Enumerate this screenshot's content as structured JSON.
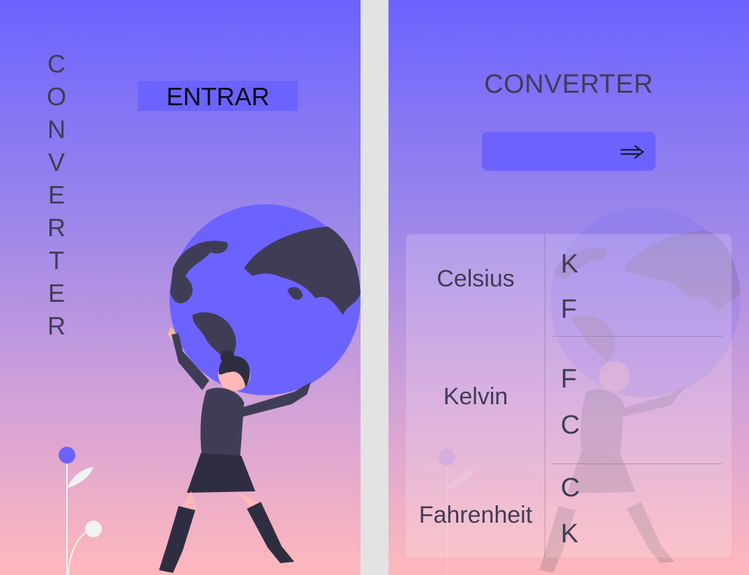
{
  "colors": {
    "accent": "#6c63ff",
    "text": "#3f3d56",
    "gradient_top": "#6c63ff",
    "gradient_bottom": "#ffb8bb",
    "divider": "#e3e3e3"
  },
  "welcome": {
    "vertical_title": [
      "C",
      "O",
      "N",
      "V",
      "E",
      "R",
      "T",
      "E",
      "R"
    ],
    "enter_label": "ENTRAR",
    "illustration": "woman-holding-globe-icon"
  },
  "converter": {
    "title": "CONVERTER",
    "go_icon": "double-arrow-right-icon",
    "rows": [
      {
        "unit": "Celsius",
        "targets": [
          "K",
          "F"
        ]
      },
      {
        "unit": "Kelvin",
        "targets": [
          "F",
          "C"
        ]
      },
      {
        "unit": "Fahrenheit",
        "targets": [
          "C",
          "K"
        ]
      }
    ]
  }
}
